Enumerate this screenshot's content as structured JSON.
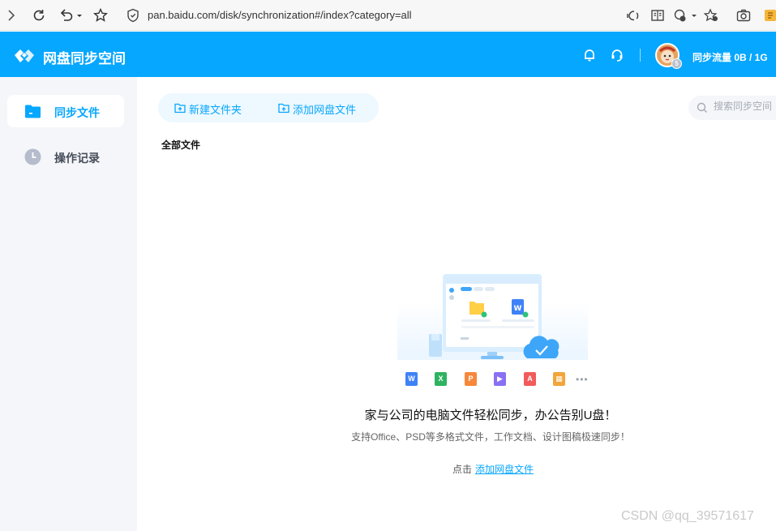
{
  "browser": {
    "url": "pan.baidu.com/disk/synchronization#/index?category=all",
    "icons": [
      "forward-icon",
      "reload-icon",
      "undo-icon",
      "favorite-icon",
      "shield-icon",
      "read-aloud-icon",
      "reader-mode-icon",
      "extension-icon",
      "favorites-icon",
      "screenshot-icon",
      "collections-icon"
    ]
  },
  "header": {
    "title": "网盘同步空间",
    "flow": "同步流量 0B / 1G",
    "avatar_badge": "5",
    "accent": "#06a7ff"
  },
  "sidebar": {
    "items": [
      {
        "label": "同步文件",
        "active": true,
        "icon": "folder-icon"
      },
      {
        "label": "操作记录",
        "active": false,
        "icon": "clock-icon"
      }
    ]
  },
  "toolbar": {
    "new_folder": "新建文件夹",
    "add_files": "添加网盘文件"
  },
  "search": {
    "placeholder": "搜索同步空间"
  },
  "breadcrumb": "全部文件",
  "empty_state": {
    "title": "家与公司的电脑文件轻松同步，办公告别U盘！",
    "subtitle": "支持Office、PSD等多格式文件，工作文档、设计图稿极速同步！",
    "action_prefix": "点击",
    "action_link": "添加网盘文件",
    "filetypes": [
      {
        "name": "word-icon",
        "letter": "W",
        "color": "#3f82f7"
      },
      {
        "name": "excel-icon",
        "letter": "X",
        "color": "#2fb361"
      },
      {
        "name": "ppt-icon",
        "letter": "P",
        "color": "#f7873a"
      },
      {
        "name": "video-icon",
        "letter": "▶",
        "color": "#8a70f2"
      },
      {
        "name": "pdf-icon",
        "letter": "A",
        "color": "#f25b5b"
      },
      {
        "name": "zip-icon",
        "letter": "▦",
        "color": "#f2a53a"
      }
    ],
    "more": "•••"
  },
  "watermark": "CSDN @qq_39571617"
}
